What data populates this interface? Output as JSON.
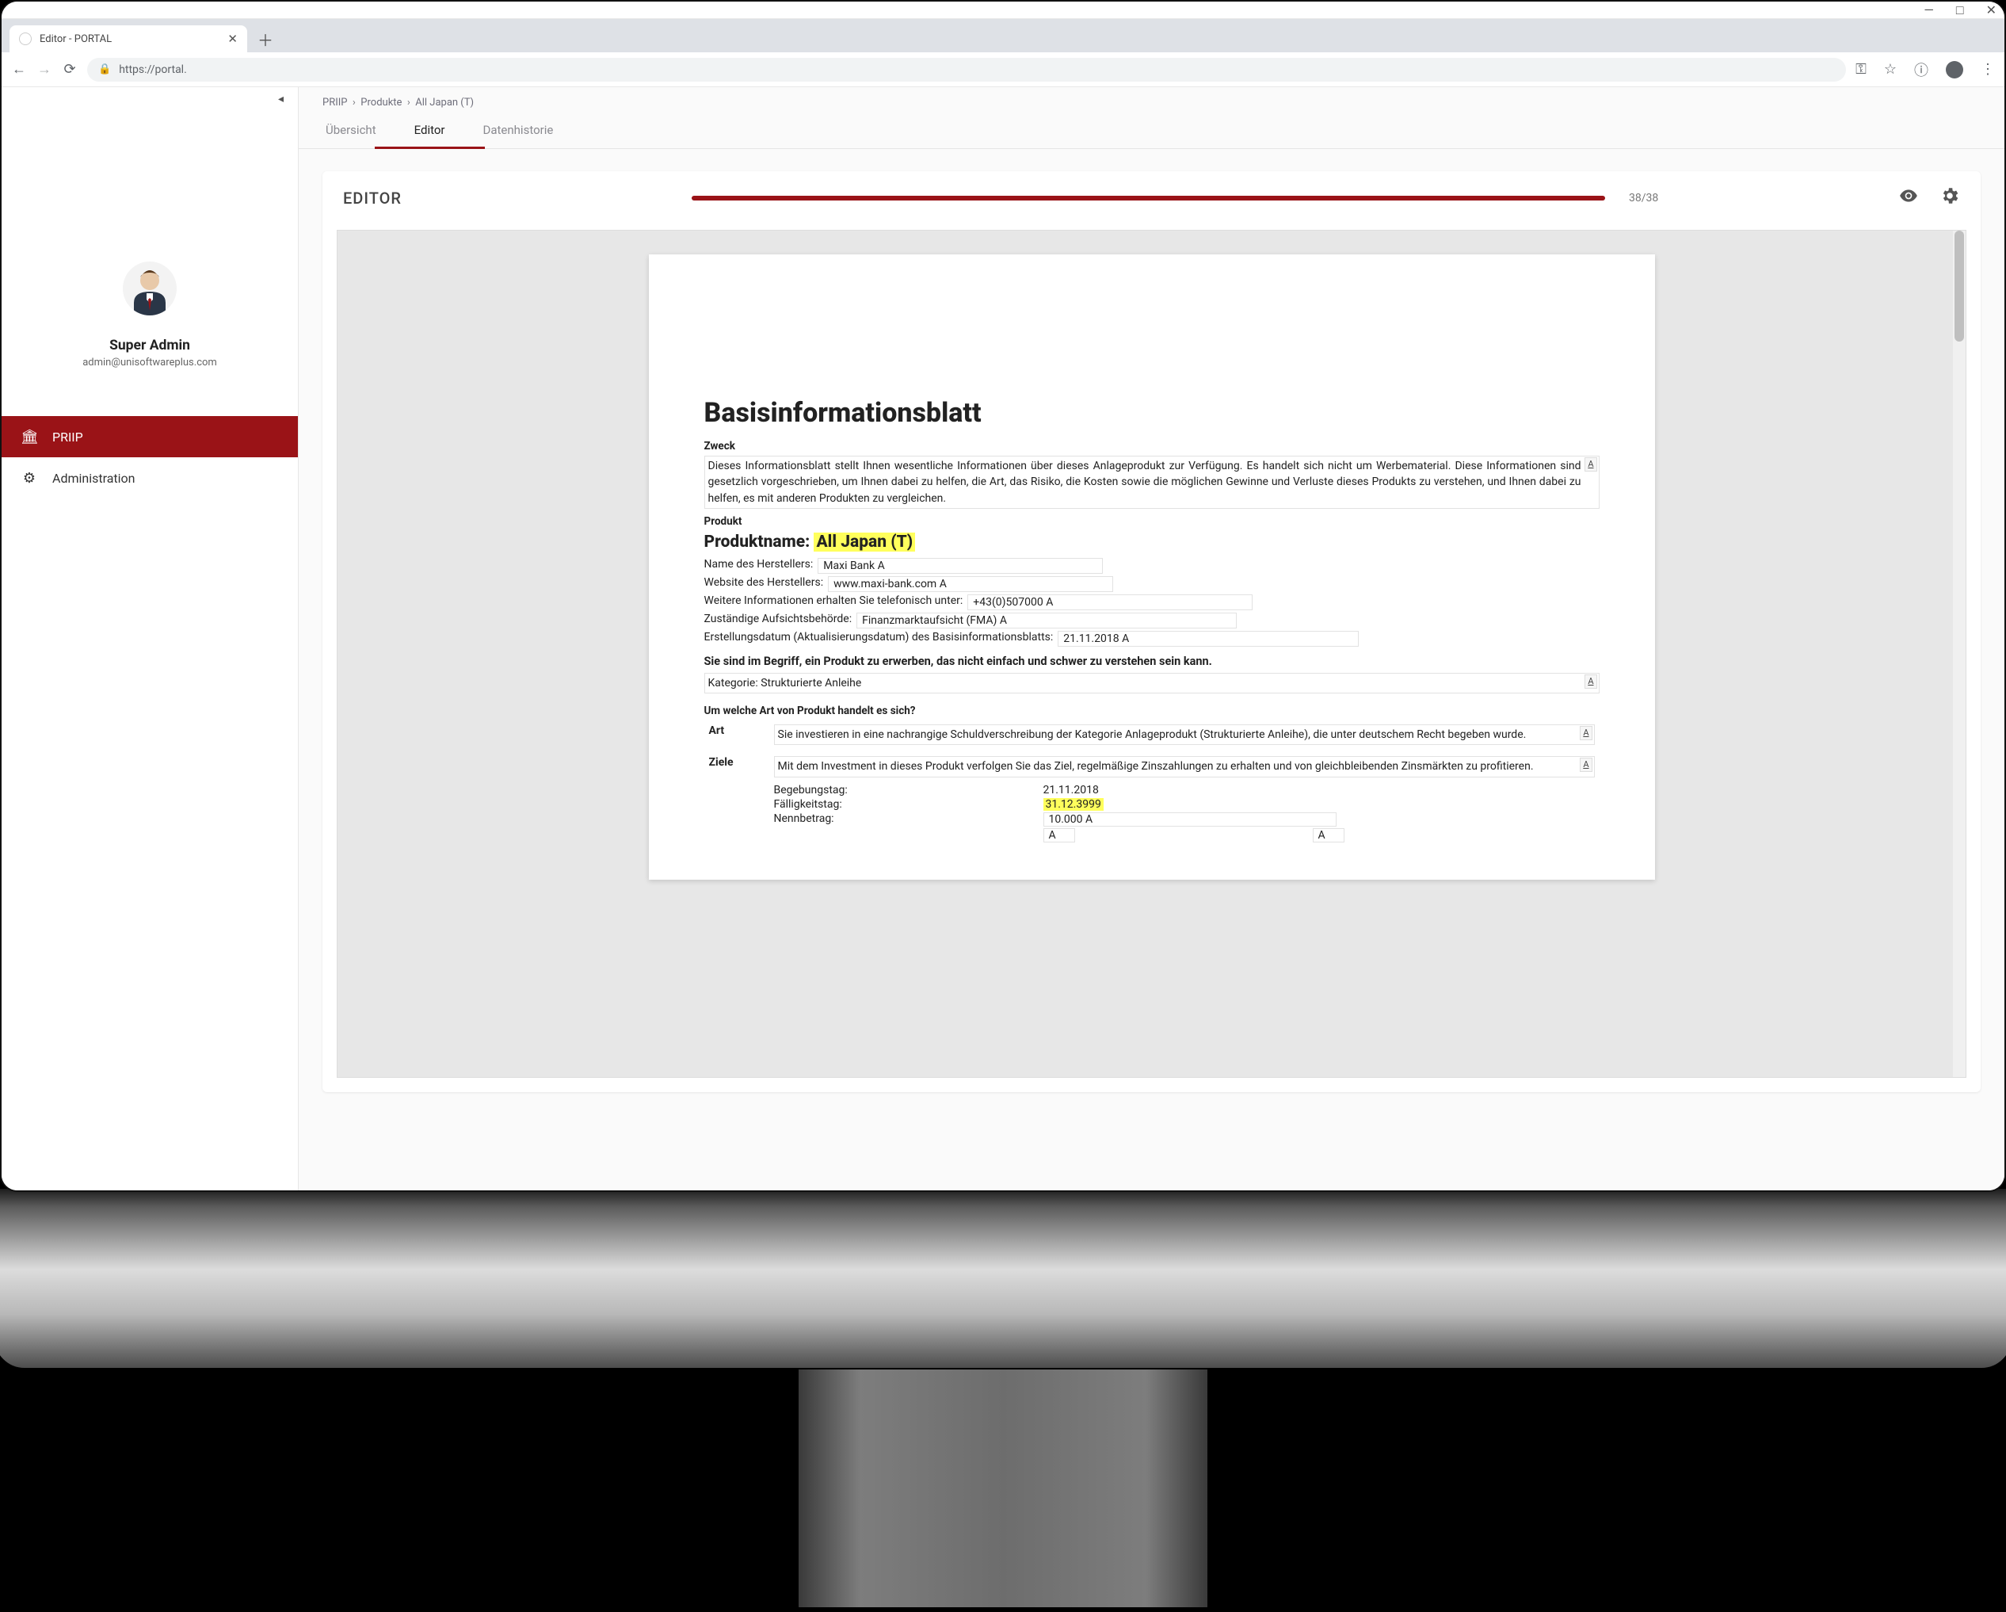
{
  "os": {
    "min": "—",
    "max": "□",
    "close": "✕"
  },
  "browser": {
    "tab_title": "Editor - PORTAL",
    "url_host": "https://portal."
  },
  "sidebar": {
    "user_name": "Super Admin",
    "user_email": "admin@unisoftwareplus.com",
    "items": [
      {
        "label": "PRIIP",
        "icon": "bank"
      },
      {
        "label": "Administration",
        "icon": "gear"
      }
    ]
  },
  "breadcrumb": {
    "a": "PRIIP",
    "b": "Produkte",
    "c": "All Japan (T)"
  },
  "tabs": {
    "overview": "Übersicht",
    "editor": "Editor",
    "history": "Datenhistorie"
  },
  "panel": {
    "title": "EDITOR",
    "progress_label": "38/38"
  },
  "doc": {
    "h1": "Basisinformationsblatt",
    "zweck_h": "Zweck",
    "zweck": "Dieses Informationsblatt stellt Ihnen wesentliche Informationen über dieses Anlageprodukt zur Verfügung. Es handelt sich nicht um Werbematerial. Diese Informationen sind gesetzlich vorgeschrieben, um Ihnen dabei zu helfen, die Art, das Risiko, die Kosten sowie die möglichen Gewinne und Verluste dieses Produkts zu verstehen, und Ihnen dabei zu helfen, es mit anderen Produkten zu vergleichen.",
    "produkt_h": "Produkt",
    "produktname_label": "Produktname:",
    "produktname_value": "All Japan (T)",
    "hersteller_label": "Name des Herstellers:",
    "hersteller_value": "Maxi Bank",
    "website_label": "Website des Herstellers:",
    "website_value": "www.maxi-bank.com",
    "tel_label": "Weitere Informationen erhalten Sie telefonisch unter:",
    "tel_value": "+43(0)507000",
    "aufsicht_label": "Zuständige Aufsichtsbehörde:",
    "aufsicht_value": "Finanzmarktaufsicht (FMA)",
    "erstell_label": "Erstellungsdatum (Aktualisierungsdatum) des Basisinformationsblatts:",
    "erstell_value": "21.11.2018",
    "warn": "Sie sind im Begriff, ein Produkt zu erwerben, das nicht einfach und schwer zu verstehen sein kann.",
    "kategorie_label": "Kategorie:",
    "kategorie_value": "Strukturierte Anleihe",
    "art_h": "Um welche Art von Produkt handelt es sich?",
    "art_label": "Art",
    "art_value": "Sie investieren in eine nachrangige Schuldverschreibung der Kategorie Anlageprodukt (Strukturierte Anleihe), die unter deutschem Recht begeben wurde.",
    "ziele_label": "Ziele",
    "ziele_value": "Mit dem Investment in dieses Produkt verfolgen Sie das Ziel, regelmäßige Zinszahlungen zu erhalten und von gleichbleibenden Zinsmärkten zu profitieren.",
    "begeb_label": "Begebungstag:",
    "begeb_value": "21.11.2018",
    "faellig_label": "Fälligkeitstag:",
    "faellig_value": "31.12.3999",
    "nenn_label": "Nennbetrag:",
    "nenn_value": "10.000",
    "a_char": "A"
  }
}
